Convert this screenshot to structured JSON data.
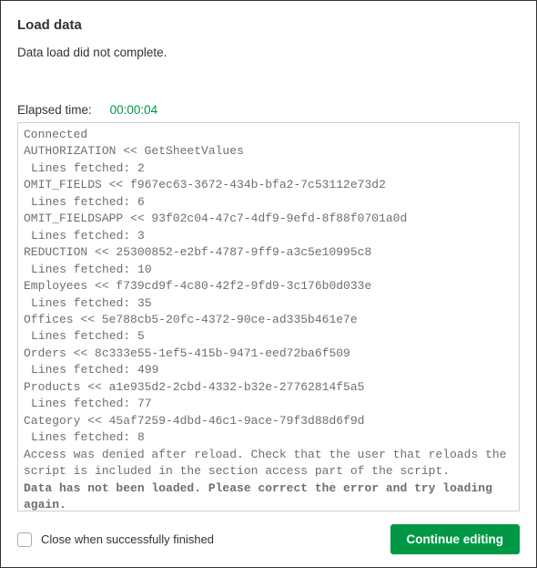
{
  "dialog": {
    "title": "Load data",
    "status_message": "Data load did not complete.",
    "elapsed_label": "Elapsed time:",
    "elapsed_value": "00:00:04",
    "log_lines": [
      {
        "text": "Connected"
      },
      {
        "text": "AUTHORIZATION << GetSheetValues"
      },
      {
        "text": "Lines fetched: 2",
        "indent": true
      },
      {
        "text": "OMIT_FIELDS << f967ec63-3672-434b-bfa2-7c53112e73d2"
      },
      {
        "text": "Lines fetched: 6",
        "indent": true
      },
      {
        "text": "OMIT_FIELDSAPP << 93f02c04-47c7-4df9-9efd-8f88f0701a0d"
      },
      {
        "text": "Lines fetched: 3",
        "indent": true
      },
      {
        "text": "REDUCTION << 25300852-e2bf-4787-9ff9-a3c5e10995c8"
      },
      {
        "text": "Lines fetched: 10",
        "indent": true
      },
      {
        "text": "Employees << f739cd9f-4c80-42f2-9fd9-3c176b0d033e"
      },
      {
        "text": "Lines fetched: 35",
        "indent": true
      },
      {
        "text": "Offices << 5e788cb5-20fc-4372-90ce-ad335b461e7e"
      },
      {
        "text": "Lines fetched: 5",
        "indent": true
      },
      {
        "text": "Orders << 8c333e55-1ef5-415b-9471-eed72ba6f509"
      },
      {
        "text": "Lines fetched: 499",
        "indent": true
      },
      {
        "text": "Products << a1e935d2-2cbd-4332-b32e-27762814f5a5"
      },
      {
        "text": "Lines fetched: 77",
        "indent": true
      },
      {
        "text": "Category << 45af7259-4dbd-46c1-9ace-79f3d88d6f9d"
      },
      {
        "text": "Lines fetched: 8",
        "indent": true
      },
      {
        "text": "Access was denied after reload. Check that the user that reloads the script is included in the section access part of the script."
      },
      {
        "text": ""
      },
      {
        "text": "Data has not been loaded. Please correct the error and try loading again.",
        "bold": true
      }
    ],
    "footer": {
      "checkbox_label": "Close when successfully finished",
      "checkbox_checked": false,
      "continue_label": "Continue editing"
    }
  }
}
